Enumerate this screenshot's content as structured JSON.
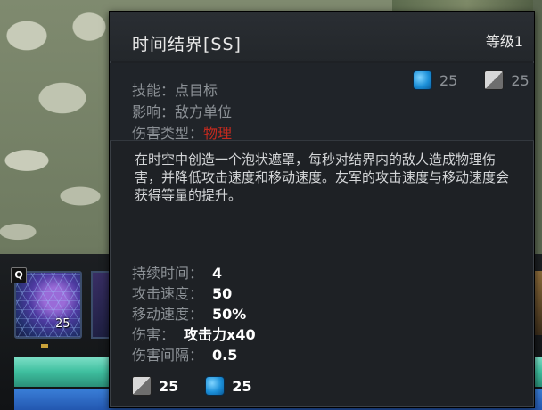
{
  "hud": {
    "hotkey": "Q",
    "slot_cost": "25"
  },
  "tooltip": {
    "title": "时间结界[SS]",
    "level": "等级1",
    "ability_label": "技能：点目标",
    "affects_label": "影响：敌方单位",
    "damage_type_prefix": "伤害类型：",
    "damage_type_value": "物理",
    "damage_type_color": "#c42a1f",
    "mana_cost": "25",
    "cooldown": "25",
    "description": "在时空中创造一个泡状遮罩，每秒对结界内的敌人造成物理伤害，并降低攻击速度和移动速度。友军的攻击速度与移动速度会获得等量的提升。",
    "stats": [
      {
        "label": "持续时间：",
        "value": "4"
      },
      {
        "label": "攻击速度：",
        "value": "50"
      },
      {
        "label": "移动速度：",
        "value": "50%"
      },
      {
        "label": "伤害：",
        "value": "攻击力x40"
      },
      {
        "label": "伤害间隔：",
        "value": "0.5"
      }
    ],
    "bottom_cooldown": "25",
    "bottom_mana": "25"
  }
}
